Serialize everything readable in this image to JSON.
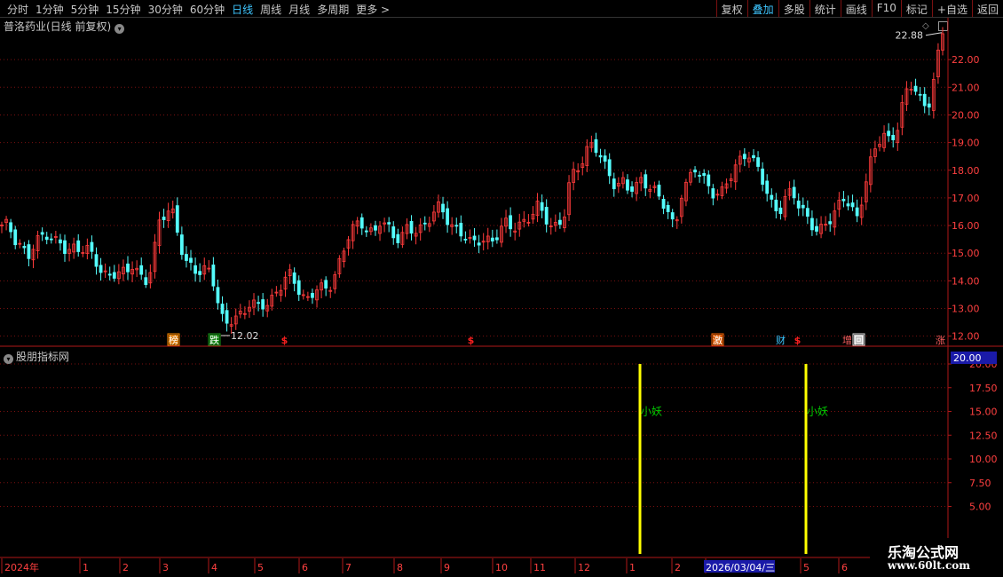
{
  "toolbar": {
    "periods": [
      "分时",
      "1分钟",
      "5分钟",
      "15分钟",
      "30分钟",
      "60分钟",
      "日线",
      "周线",
      "月线",
      "多周期",
      "更多 >"
    ],
    "active_period": "日线",
    "actions": [
      "复权",
      "叠加",
      "多股",
      "统计",
      "画线",
      "F10",
      "标记",
      "+自选",
      "返回"
    ],
    "active_action": "叠加"
  },
  "stock_title": "普洛药业(日线 前复权)",
  "indicator_title": "股朋指标网",
  "watermark": {
    "line1": "乐淘公式网",
    "line2": "www.60lt.com"
  },
  "colors": {
    "up": "#ff3b3b",
    "down": "#54fcfc",
    "grid": "#7a1010",
    "axis": "#b01818",
    "bar": "#ffff00",
    "label": "#00cc00"
  },
  "chart_data": [
    {
      "type": "candlestick",
      "title": "普洛药业(日线 前复权)",
      "ylim": [
        11.7,
        23.0
      ],
      "yticks": [
        "12.00",
        "13.00",
        "14.00",
        "15.00",
        "16.00",
        "17.00",
        "18.00",
        "19.00",
        "20.00",
        "21.00",
        "22.00"
      ],
      "annotations": {
        "max": "22.88",
        "min": "12.02"
      },
      "markers": [
        "榜",
        "跌",
        "$",
        "$",
        "激",
        "财",
        "$",
        "增",
        "回",
        "涨"
      ],
      "close_path": [
        15.9,
        16.0,
        15.6,
        15.3,
        14.8,
        15.2,
        15.6,
        15.8,
        15.5,
        15.3,
        14.9,
        15.2,
        15.3,
        15.2,
        14.8,
        14.3,
        14.2,
        14.4,
        14.3,
        14.2,
        14.5,
        14.3,
        14.1,
        14.5,
        16.0,
        16.4,
        16.7,
        15.8,
        14.6,
        14.4,
        14.3,
        14.5,
        14.5,
        13.2,
        12.3,
        12.6,
        12.8,
        12.9,
        13.1,
        13.0,
        13.2,
        13.3,
        13.6,
        13.8,
        14.2,
        14.0,
        13.5,
        13.3,
        13.6,
        13.7,
        13.8,
        14.3,
        14.8,
        15.5,
        16.0,
        16.2,
        15.9,
        15.6,
        16.1,
        16.0,
        15.7,
        15.6,
        15.8,
        15.7,
        15.9,
        16.2,
        16.5,
        16.6,
        16.2,
        16.0,
        15.9,
        15.6,
        15.2,
        15.4,
        15.6,
        15.5,
        15.7,
        16.0,
        15.9,
        16.1,
        16.2,
        16.3,
        16.6,
        16.4,
        16.1,
        16.0,
        16.2,
        17.6,
        18.1,
        18.5,
        19.0,
        18.7,
        18.2,
        17.9,
        17.5,
        17.6,
        17.2,
        17.3,
        17.8,
        17.5,
        17.2,
        16.8,
        16.4,
        16.0,
        17.2,
        17.5,
        18.0,
        17.8,
        17.6,
        17.2,
        17.0,
        17.5,
        18.0,
        18.5,
        18.7,
        18.2,
        17.9,
        17.3,
        16.8,
        16.5,
        16.9,
        17.2,
        16.8,
        16.5,
        16.0,
        15.6,
        16.0,
        16.4,
        16.8,
        17.0,
        16.5,
        16.2,
        17.5,
        18.4,
        18.9,
        19.2,
        19.0,
        19.6,
        20.6,
        21.0,
        20.8,
        20.3,
        20.6,
        21.8,
        22.88
      ],
      "x_labels": [
        "2024年",
        "1",
        "2",
        "3",
        "4",
        "5",
        "6",
        "7",
        "8",
        "9",
        "10",
        "11",
        "12",
        "1",
        "2",
        "2026/03/04/三",
        "5",
        "6"
      ]
    },
    {
      "type": "bar",
      "title": "股朋指标网",
      "ylim": [
        0,
        20
      ],
      "yticks": [
        "5.00",
        "7.50",
        "10.00",
        "12.50",
        "15.00",
        "17.50",
        "20.00"
      ],
      "current_value": "20.00",
      "series": [
        {
          "values": [
            20,
            20
          ]
        }
      ],
      "bar_labels": [
        "小妖",
        "小妖"
      ]
    }
  ]
}
